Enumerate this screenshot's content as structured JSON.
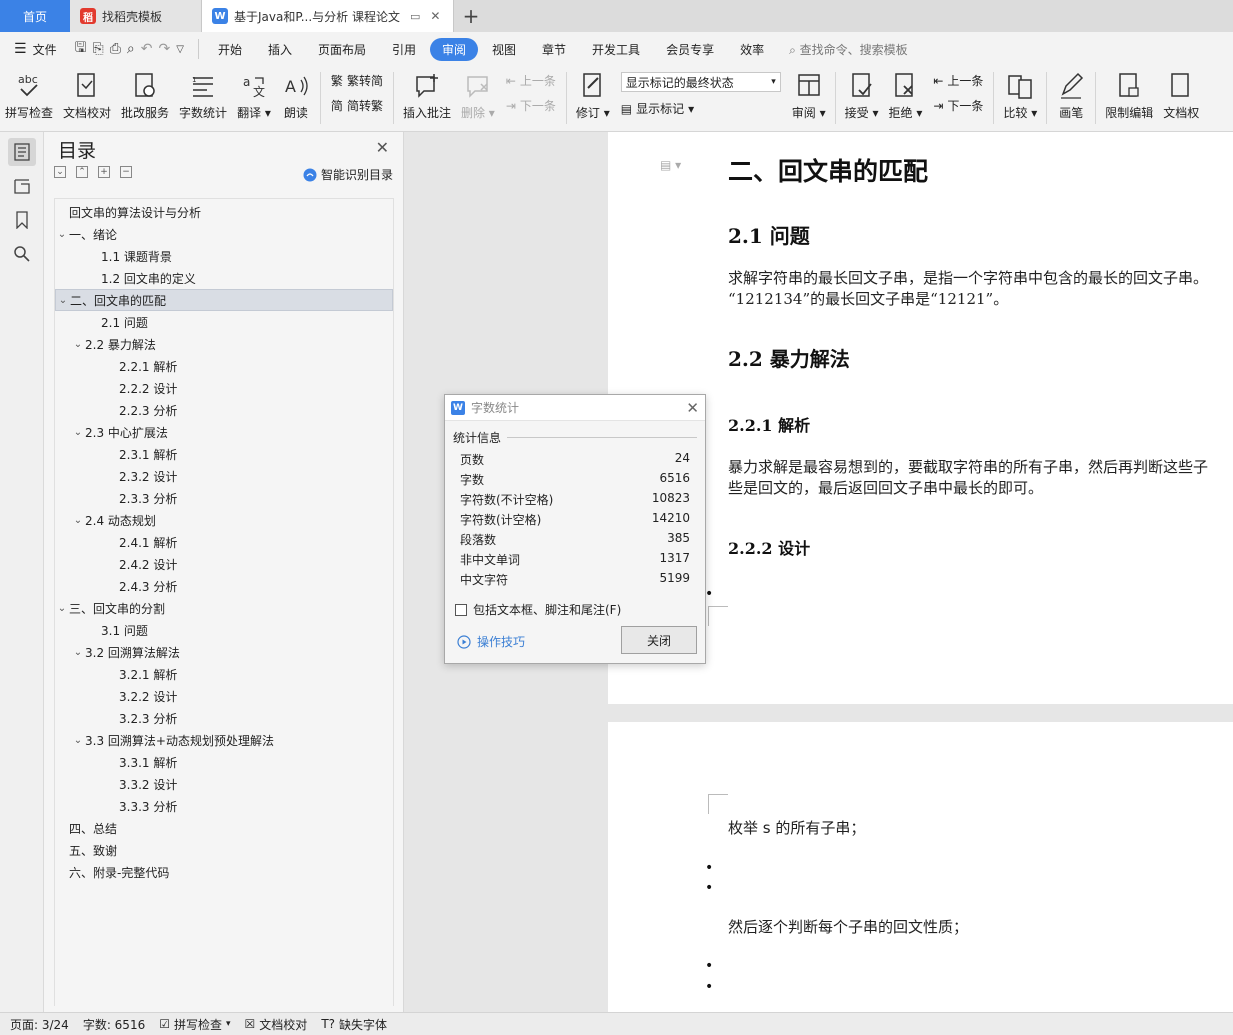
{
  "tabs": {
    "home": "首页",
    "items": [
      {
        "label": "找稻壳模板"
      },
      {
        "label": "基于Java和P...与分析 课程论文"
      }
    ],
    "add": "+"
  },
  "menu": {
    "file": "文件",
    "items": [
      "开始",
      "插入",
      "页面布局",
      "引用",
      "审阅",
      "视图",
      "章节",
      "开发工具",
      "会员专享",
      "效率"
    ],
    "active": "审阅",
    "search_placeholder": "查找命令、搜索模板"
  },
  "ribbon": {
    "spell_check": "拼写检查",
    "doc_proof": "文档校对",
    "approve_service": "批改服务",
    "word_count": "字数统计",
    "translate": "翻译",
    "read_aloud": "朗读",
    "trad_to_simp": "繁转简",
    "simp_to_trad": "简转繁",
    "insert_comment": "插入批注",
    "delete": "删除",
    "prev_comment": "上一条",
    "next_comment": "下一条",
    "revise": "修订",
    "markup_state": "显示标记的最终状态",
    "show_markup": "显示标记",
    "review": "审阅",
    "accept": "接受",
    "reject": "拒绝",
    "prev_change": "上一条",
    "next_change": "下一条",
    "compare": "比较",
    "ink": "画笔",
    "restrict_edit": "限制编辑",
    "doc_rights": "文档权"
  },
  "toc": {
    "title": "目录",
    "smart_label": "智能识别目录",
    "items": [
      {
        "text": "回文串的算法设计与分析",
        "level": 0,
        "arrow": ""
      },
      {
        "text": "一、绪论",
        "level": 0,
        "arrow": "v"
      },
      {
        "text": "1.1  课题背景",
        "level": 1,
        "arrow": ""
      },
      {
        "text": "1.2  回文串的定义",
        "level": 1,
        "arrow": ""
      },
      {
        "text": "二、回文串的匹配",
        "level": 0,
        "arrow": "v",
        "selected": true
      },
      {
        "text": "2.1  问题",
        "level": 1,
        "arrow": ""
      },
      {
        "text": "2.2  暴力解法",
        "level": 1,
        "arrow": "v"
      },
      {
        "text": "2.2.1  解析",
        "level": 2,
        "arrow": ""
      },
      {
        "text": "2.2.2  设计",
        "level": 2,
        "arrow": ""
      },
      {
        "text": "2.2.3  分析",
        "level": 2,
        "arrow": ""
      },
      {
        "text": "2.3  中心扩展法",
        "level": 1,
        "arrow": "v"
      },
      {
        "text": "2.3.1  解析",
        "level": 2,
        "arrow": ""
      },
      {
        "text": "2.3.2  设计",
        "level": 2,
        "arrow": ""
      },
      {
        "text": "2.3.3  分析",
        "level": 2,
        "arrow": ""
      },
      {
        "text": "2.4  动态规划",
        "level": 1,
        "arrow": "v"
      },
      {
        "text": "2.4.1  解析",
        "level": 2,
        "arrow": ""
      },
      {
        "text": "2.4.2  设计",
        "level": 2,
        "arrow": ""
      },
      {
        "text": "2.4.3  分析",
        "level": 2,
        "arrow": ""
      },
      {
        "text": "三、回文串的分割",
        "level": 0,
        "arrow": "v"
      },
      {
        "text": "3.1  问题",
        "level": 1,
        "arrow": ""
      },
      {
        "text": "3.2  回溯算法解法",
        "level": 1,
        "arrow": "v"
      },
      {
        "text": "3.2.1  解析",
        "level": 2,
        "arrow": ""
      },
      {
        "text": "3.2.2  设计",
        "level": 2,
        "arrow": ""
      },
      {
        "text": "3.2.3  分析",
        "level": 2,
        "arrow": ""
      },
      {
        "text": "3.3  回溯算法+动态规划预处理解法",
        "level": 1,
        "arrow": "v"
      },
      {
        "text": "3.3.1  解析",
        "level": 2,
        "arrow": ""
      },
      {
        "text": "3.3.2  设计",
        "level": 2,
        "arrow": ""
      },
      {
        "text": "3.3.3  分析",
        "level": 2,
        "arrow": ""
      },
      {
        "text": "四、总结",
        "level": 0,
        "arrow": ""
      },
      {
        "text": "五、致谢",
        "level": 0,
        "arrow": ""
      },
      {
        "text": "六、附录-完整代码",
        "level": 0,
        "arrow": ""
      }
    ]
  },
  "document": {
    "h1": "二、回文串的匹配",
    "h2_1": "2.1  问题",
    "p1_line1": "求解字符串的最长回文子串，是指一个字符串中包含的最长的回文子串。",
    "p1_line2": "“1212134”的最长回文子串是“12121”。",
    "h2_2": "2.2  暴力解法",
    "h3_1": "2.2.1  解析",
    "p2_line1": "暴力求解是最容易想到的，要截取字符串的所有子串，然后再判断这些子",
    "p2_line2": "些是回文的，最后返回回文子串中最长的即可。",
    "h3_2": "2.2.2  设计",
    "bullet": "•",
    "p3": "枚举  s  的所有子串；",
    "p4": "然后逐个判断每个子串的回文性质；"
  },
  "dialog": {
    "title": "字数统计",
    "section": "统计信息",
    "stats": [
      {
        "label": "页数",
        "value": "24"
      },
      {
        "label": "字数",
        "value": "6516"
      },
      {
        "label": "字符数(不计空格)",
        "value": "10823"
      },
      {
        "label": "字符数(计空格)",
        "value": "14210"
      },
      {
        "label": "段落数",
        "value": "385"
      },
      {
        "label": "非中文单词",
        "value": "1317"
      },
      {
        "label": "中文字符",
        "value": "5199"
      }
    ],
    "include_label": "包括文本框、脚注和尾注(F)",
    "tips": "操作技巧",
    "close": "关闭"
  },
  "status": {
    "page": "页面: 3/24",
    "words": "字数: 6516",
    "spell": "拼写检查",
    "proof": "文档校对",
    "missing_font": "缺失字体"
  },
  "colors": {
    "accent": "#3b82e6",
    "wps_red": "#e23a2e"
  }
}
